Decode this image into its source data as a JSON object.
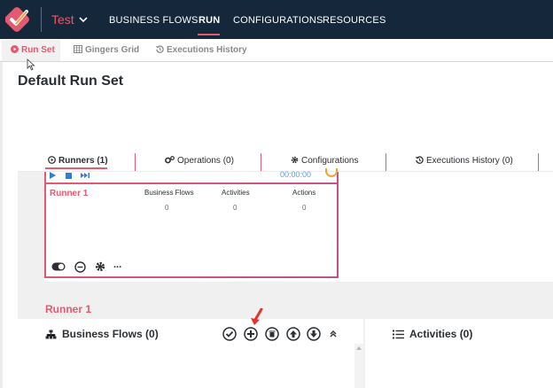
{
  "header": {
    "solution_name": "Test",
    "nav": [
      "BUSINESS FLOWS",
      "RUN",
      "CONFIGURATIONS",
      "RESOURCES"
    ],
    "active_nav": "RUN"
  },
  "subtabs": [
    "Run Set",
    "Gingers Grid",
    "Executions History"
  ],
  "page_title": "Default Run Set",
  "runner_tabs": [
    "Runners (1)",
    "Operations (0)",
    "Configurations",
    "Executions History (0)"
  ],
  "runner_card": {
    "timer": "00:00:00",
    "name": "Runner 1",
    "columns": [
      {
        "label": "Business Flows",
        "value": "0"
      },
      {
        "label": "Activities",
        "value": "0"
      },
      {
        "label": "Actions",
        "value": "0"
      }
    ],
    "more_label": "..."
  },
  "runner_section": {
    "title": "Runner 1",
    "business_flows_title": "Business Flows (0)",
    "activities_title": "Activities (0)"
  },
  "colors": {
    "topbar": "#15273a",
    "accent": "#e55a6e",
    "timer": "#5a9cd6"
  }
}
